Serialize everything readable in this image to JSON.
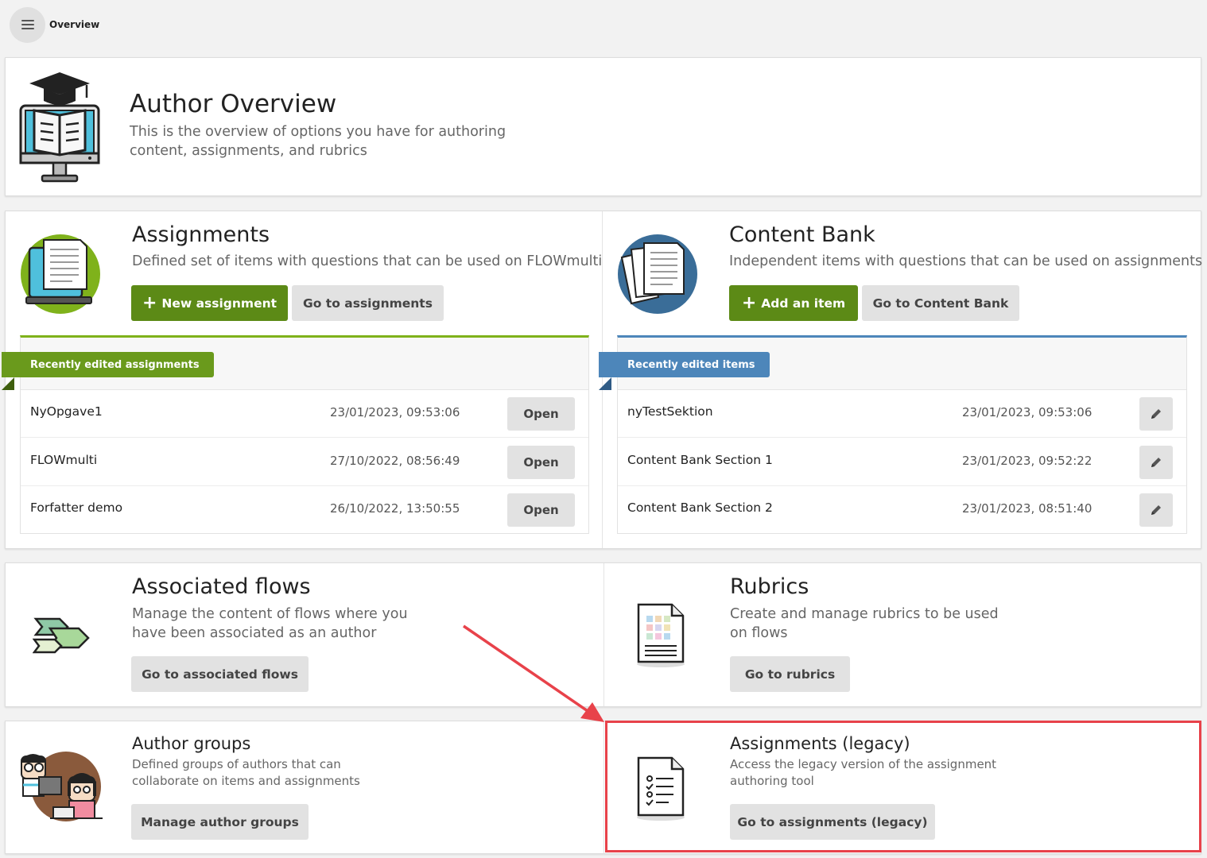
{
  "breadcrumb": {
    "current": "Overview"
  },
  "overview": {
    "title": "Author Overview",
    "description": "This is the overview of options you have for authoring content, assignments, and rubrics"
  },
  "assignments": {
    "title": "Assignments",
    "description": "Defined set of items with questions that can be used on FLOWmulti",
    "new_button": "New assignment",
    "go_button": "Go to assignments",
    "ribbon": "Recently edited assignments",
    "open_label": "Open",
    "rows": [
      {
        "name": "NyOpgave1",
        "date": "23/01/2023, 09:53:06"
      },
      {
        "name": "FLOWmulti",
        "date": "27/10/2022, 08:56:49"
      },
      {
        "name": "Forfatter demo",
        "date": "26/10/2022, 13:50:55"
      }
    ]
  },
  "content_bank": {
    "title": "Content Bank",
    "description": "Independent items with questions that can be used on assignments",
    "add_button": "Add an item",
    "go_button": "Go to Content Bank",
    "ribbon": "Recently edited items",
    "rows": [
      {
        "name": "nyTestSektion",
        "date": "23/01/2023, 09:53:06"
      },
      {
        "name": "Content Bank Section 1",
        "date": "23/01/2023, 09:52:22"
      },
      {
        "name": "Content Bank Section 2",
        "date": "23/01/2023, 08:51:40"
      }
    ]
  },
  "associated_flows": {
    "title": "Associated flows",
    "description": "Manage the content of flows where you have been associated as an author",
    "button": "Go to associated flows"
  },
  "rubrics": {
    "title": "Rubrics",
    "description": "Create and manage rubrics to be used on flows",
    "button": "Go to rubrics"
  },
  "author_groups": {
    "title": "Author groups",
    "description": "Defined groups of authors that can collaborate on items and assignments",
    "button": "Manage author groups"
  },
  "legacy": {
    "title": "Assignments (legacy)",
    "description": "Access the legacy version of the assignment authoring tool",
    "button": "Go to assignments (legacy)"
  },
  "colors": {
    "accent_green": "#5c8a16",
    "accent_blue": "#4d86ba",
    "highlight_red": "#e8424a"
  }
}
